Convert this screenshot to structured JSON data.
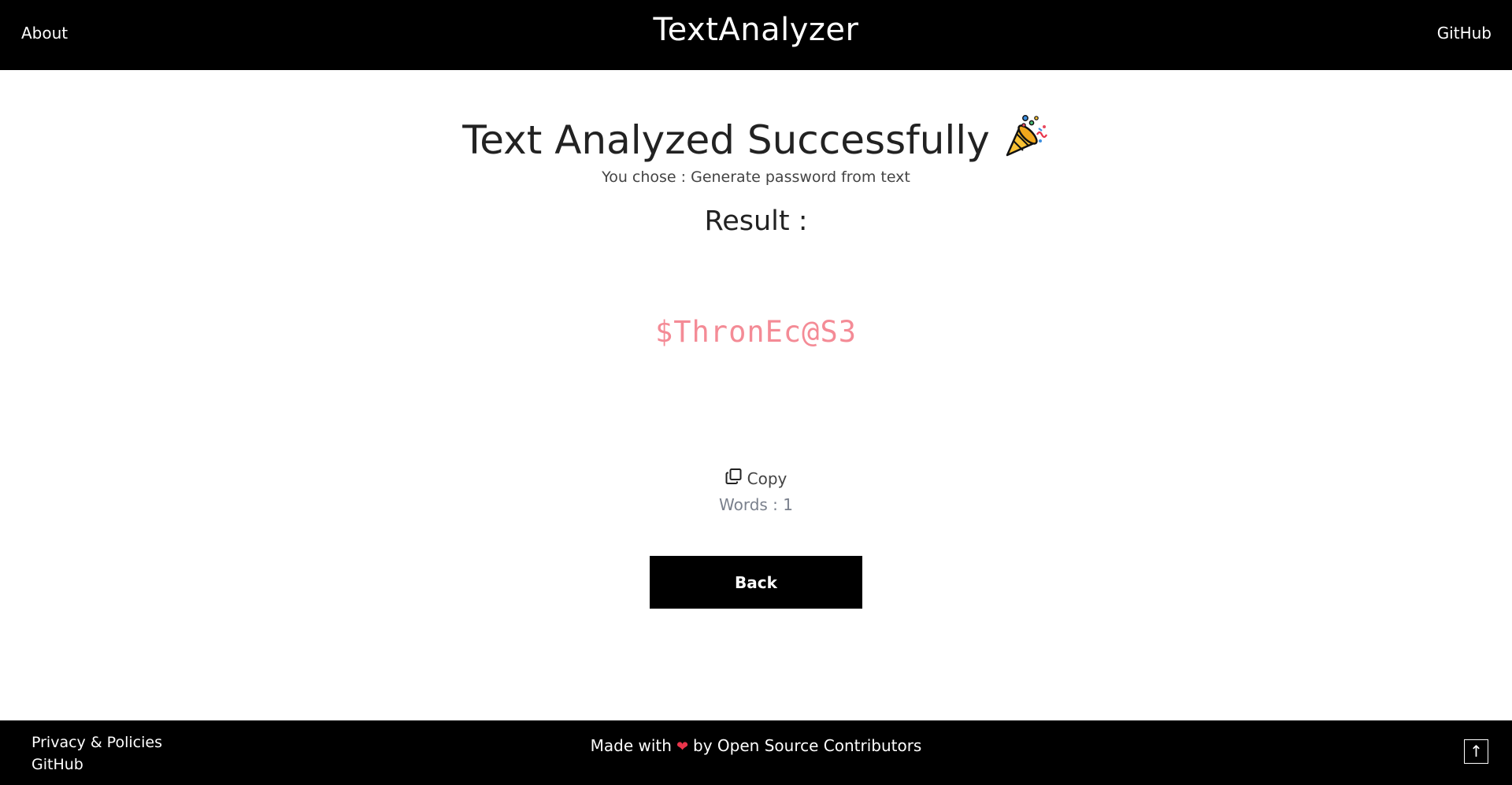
{
  "navbar": {
    "brand": "TextAnalyzer",
    "about_label": "About",
    "github_label": "GitHub"
  },
  "main": {
    "heading": "Text Analyzed Successfully",
    "heading_icon": "party-popper-icon",
    "choice_text": "You chose : Generate password from text",
    "result_label": "Result :",
    "result_value": "$ThronEc@S3",
    "copy_label": "Copy",
    "words_text": "Words : 1",
    "back_label": "Back"
  },
  "footer": {
    "privacy_label": "Privacy & Policies",
    "github_label": "GitHub",
    "credit_prefix": "Made with",
    "credit_suffix": "by Open Source Contributors",
    "heart_icon": "heart-icon",
    "scroll_top_icon": "arrow-up-icon"
  },
  "colors": {
    "bar_background": "#000000",
    "result_accent": "#f48b96",
    "heart": "#e8344a"
  }
}
